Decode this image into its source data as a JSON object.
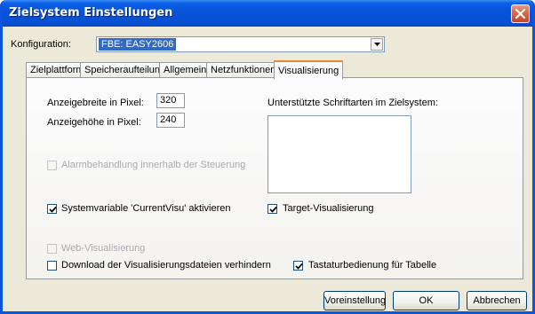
{
  "window": {
    "title": "Zielsystem Einstellungen"
  },
  "config": {
    "label": "Konfiguration:",
    "value": "FBE: EASY2606"
  },
  "tabs": [
    "Zielplattform",
    "Speicheraufteilung",
    "Allgemein",
    "Netzfunktionen",
    "Visualisierung"
  ],
  "active_tab": "Visualisierung",
  "fields": {
    "width_label": "Anzeigebreite in Pixel:",
    "width_value": "320",
    "height_label": "Anzeigehöhe in Pixel:",
    "height_value": "240",
    "fonts_label": "Unterstützte Schriftarten im Zielsystem:"
  },
  "checkboxes": {
    "alarm": {
      "label": "Alarmbehandlung innerhalb der Steuerung",
      "checked": false,
      "enabled": false
    },
    "current_visu": {
      "label": "Systemvariable 'CurrentVisu' aktivieren",
      "checked": true,
      "enabled": true
    },
    "target_visu": {
      "label": "Target-Visualisierung",
      "checked": true,
      "enabled": true
    },
    "web_visu": {
      "label": "Web-Visualisierung",
      "checked": false,
      "enabled": false
    },
    "download": {
      "label": "Download der Visualisierungsdateien verhindern",
      "checked": false,
      "enabled": true
    },
    "keyboard": {
      "label": "Tastaturbedienung für Tabelle",
      "checked": true,
      "enabled": true
    }
  },
  "buttons": {
    "default": "Voreinstellung",
    "ok": "OK",
    "cancel": "Abbrechen"
  },
  "colors": {
    "titlebar": "#0753d8",
    "dialog_bg": "#ece9d8",
    "selection": "#316ac5",
    "tab_highlight": "#e68b2c"
  }
}
